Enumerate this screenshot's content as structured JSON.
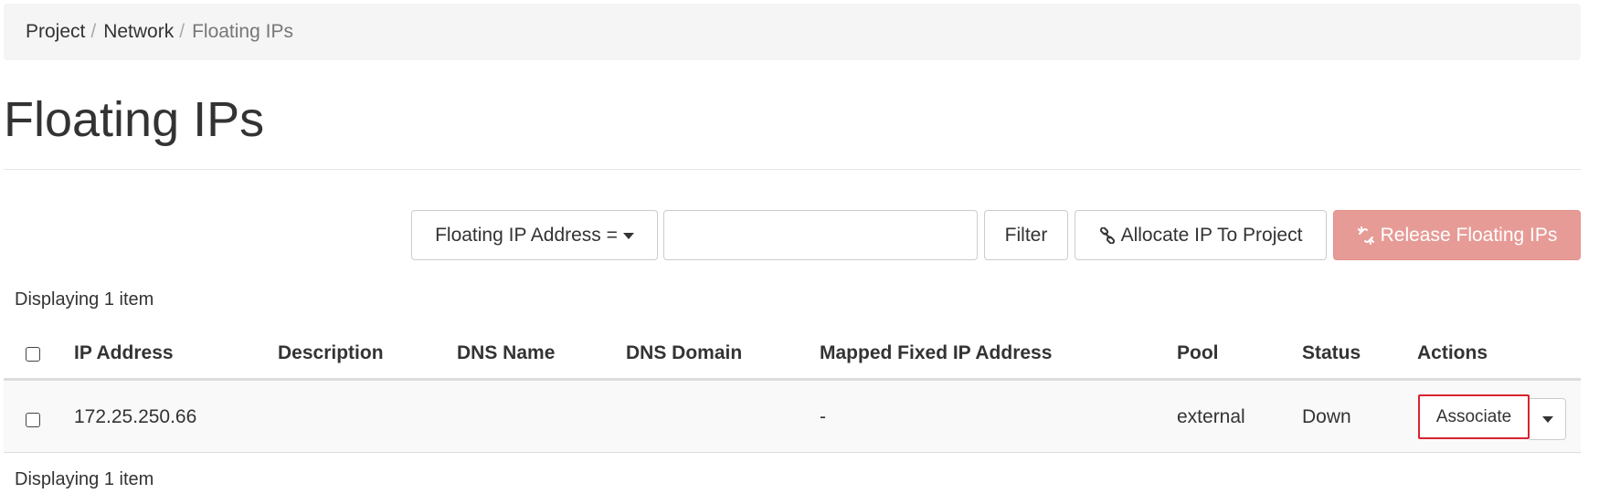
{
  "breadcrumb": {
    "items": [
      "Project",
      "Network",
      "Floating IPs"
    ],
    "separator": "/"
  },
  "page": {
    "title": "Floating IPs"
  },
  "toolbar": {
    "filter_field_label": "Floating IP Address =",
    "filter_input_value": "",
    "filter_button": "Filter",
    "allocate_button": "Allocate IP To Project",
    "release_button": "Release Floating IPs",
    "release_color": "#e79b96"
  },
  "table": {
    "count_text": "Displaying 1 item",
    "columns": [
      "IP Address",
      "Description",
      "DNS Name",
      "DNS Domain",
      "Mapped Fixed IP Address",
      "Pool",
      "Status",
      "Actions"
    ],
    "rows": [
      {
        "ip_address": "172.25.250.66",
        "description": "",
        "dns_name": "",
        "dns_domain": "",
        "mapped_fixed_ip": "-",
        "pool": "external",
        "status": "Down",
        "action": "Associate"
      }
    ]
  },
  "icons": {
    "filter_caret": "caret-down-icon",
    "allocate": "link-icon",
    "release": "unlink-icon",
    "actions_toggle": "caret-down-icon"
  },
  "colors": {
    "highlight_border": "#d9232e"
  }
}
